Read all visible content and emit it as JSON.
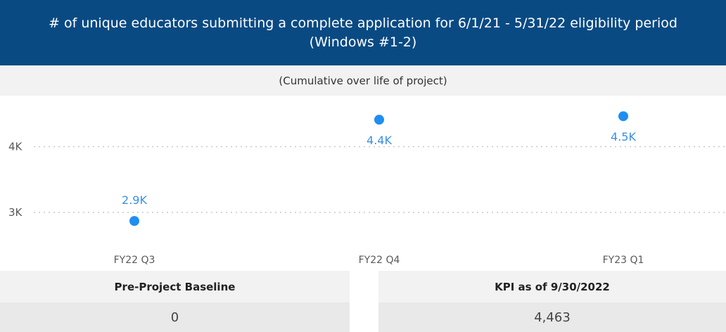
{
  "header": {
    "title": "# of unique educators submitting a complete application for 6/1/21 - 5/31/22 eligibility period (Windows #1-2)"
  },
  "subtitle": "(Cumulative over life of project)",
  "chart_data": {
    "type": "scatter",
    "title": "# of unique educators submitting a complete application for 6/1/21 - 5/31/22 eligibility period (Windows #1-2)",
    "subtitle": "(Cumulative over life of project)",
    "categories": [
      "FY22 Q3",
      "FY22 Q4",
      "FY23 Q1"
    ],
    "values": [
      2870,
      4410,
      4463
    ],
    "data_labels": [
      "2.9K",
      "4.4K",
      "4.5K"
    ],
    "yticks": [
      {
        "value": 3000,
        "label": "3K"
      },
      {
        "value": 4000,
        "label": "4K"
      }
    ],
    "grid": true,
    "color": "#1f8ef1"
  },
  "kpis": {
    "baseline": {
      "label": "Pre-Project Baseline",
      "value": "0"
    },
    "current": {
      "label": "KPI as of 9/30/2022",
      "value": "4,463"
    }
  }
}
